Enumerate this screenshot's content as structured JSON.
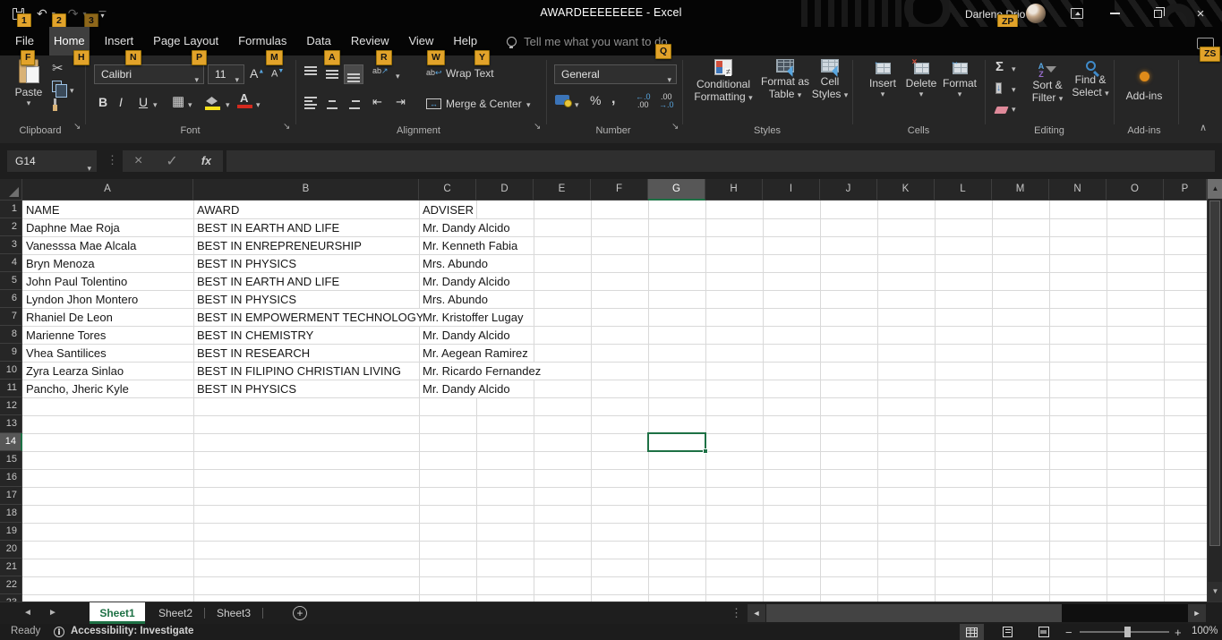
{
  "titlebar": {
    "title": "AWARDEEEEEEEE - Excel",
    "user": "Darlene Drio"
  },
  "keytips": {
    "qat1": "1",
    "qat2": "2",
    "qat3": "3",
    "file": "F",
    "home": "H",
    "insert": "N",
    "page_layout": "P",
    "formulas": "M",
    "data": "A",
    "review": "R",
    "view": "W",
    "help": "Y",
    "tellme": "Q",
    "account": "ZP",
    "comments": "ZS"
  },
  "tabs": [
    {
      "label": "File"
    },
    {
      "label": "Home"
    },
    {
      "label": "Insert"
    },
    {
      "label": "Page Layout"
    },
    {
      "label": "Formulas"
    },
    {
      "label": "Data"
    },
    {
      "label": "Review"
    },
    {
      "label": "View"
    },
    {
      "label": "Help"
    }
  ],
  "tellme": "Tell me what you want to do",
  "ribbon": {
    "clipboard": {
      "label": "Clipboard",
      "paste": "Paste"
    },
    "font": {
      "label": "Font",
      "font_name": "Calibri",
      "font_size": "11",
      "bold": "B",
      "italic": "I",
      "underline": "U"
    },
    "alignment": {
      "label": "Alignment",
      "wrap_text": "Wrap Text",
      "merge_center": "Merge & Center",
      "wrap_ab": "ab",
      "orient_ab": "ab"
    },
    "number": {
      "label": "Number",
      "format": "General",
      "percent": "%",
      "comma": ",",
      "inc_top": "←.0",
      "inc_bot": ".00",
      "dec_top": ".00",
      "dec_bot": "→.0"
    },
    "styles": {
      "label": "Styles",
      "cf1": "Conditional",
      "cf2": "Formatting",
      "ft1": "Format as",
      "ft2": "Table",
      "cs1": "Cell",
      "cs2": "Styles",
      "neq": "≠"
    },
    "cells": {
      "label": "Cells",
      "insert": "Insert",
      "delete": "Delete",
      "format": "Format",
      "del_x": "×",
      "ins_a": "←",
      "fmt_a": "↔"
    },
    "editing": {
      "label": "Editing",
      "sf1": "Sort &",
      "sf2": "Filter",
      "fs1": "Find &",
      "fs2": "Select",
      "az_a": "A",
      "az_z": "Z"
    },
    "addins": {
      "label": "Add-ins",
      "button": "Add-ins"
    }
  },
  "formula_bar": {
    "name_box": "G14",
    "formula": "",
    "fx": "fx"
  },
  "icons": {
    "caret_down": "▾",
    "undo": "↶",
    "redo": "↷",
    "cut": "✂",
    "dots_v": "⋮",
    "launcher": "↘",
    "check": "✓",
    "cancel": "×",
    "sigma": "Σ",
    "fill_down": "↓",
    "wrap_return": "↩",
    "merge_arrows": "↔",
    "orient_arrow": "↗",
    "indent_dec": "⇤",
    "indent_inc": "⇥",
    "borders": "▦",
    "left_arrow": "◄",
    "right_arrow": "►",
    "up_arrow": "▲",
    "down_arrow": "▼",
    "grow_mark": "▲",
    "shrink_mark": "▼",
    "letter_a": "A",
    "plus": "+",
    "minus": "−",
    "collapse": "∧",
    "close": "×"
  },
  "grid": {
    "columns": [
      "A",
      "B",
      "C",
      "D",
      "E",
      "F",
      "G",
      "H",
      "I",
      "J",
      "K",
      "L",
      "M",
      "N",
      "O",
      "P"
    ],
    "selected_column": "G",
    "selected_row": 14,
    "selected_cell": "G14",
    "rows": [
      [
        "NAME",
        "AWARD",
        "ADVISER"
      ],
      [
        "Daphne Mae Roja",
        "BEST IN EARTH AND LIFE",
        "Mr. Dandy Alcido"
      ],
      [
        "Vanesssa Mae Alcala",
        "BEST IN ENREPRENEURSHIP",
        "Mr. Kenneth Fabia"
      ],
      [
        "Bryn Menoza",
        "BEST IN PHYSICS",
        "Mrs. Abundo"
      ],
      [
        "John Paul Tolentino",
        "BEST IN EARTH AND LIFE",
        "Mr. Dandy Alcido"
      ],
      [
        "Lyndon Jhon Montero",
        "BEST IN PHYSICS",
        "Mrs. Abundo"
      ],
      [
        "Rhaniel De Leon",
        "BEST IN EMPOWERMENT TECHNOLOGY",
        "Mr. Kristoffer Lugay"
      ],
      [
        "Marienne Tores",
        "BEST IN CHEMISTRY",
        "Mr. Dandy Alcido"
      ],
      [
        "Vhea Santilices",
        "BEST IN RESEARCH",
        "Mr. Aegean Ramirez"
      ],
      [
        "Zyra Learza Sinlao",
        "BEST IN FILIPINO CHRISTIAN LIVING",
        "Mr. Ricardo Fernandez"
      ],
      [
        "Pancho, Jheric Kyle",
        "BEST IN PHYSICS",
        "Mr. Dandy Alcido"
      ]
    ]
  },
  "sheet_tabs": {
    "tabs": [
      "Sheet1",
      "Sheet2",
      "Sheet3"
    ],
    "active": "Sheet1"
  },
  "status_bar": {
    "ready": "Ready",
    "accessibility": "Accessibility: Investigate",
    "zoom": "100%"
  },
  "colors": {
    "excel_green": "#1e7145",
    "keytip_gold": "#e2a32a",
    "fill_yellow": "#f7e11a",
    "font_red": "#d42a1e"
  }
}
